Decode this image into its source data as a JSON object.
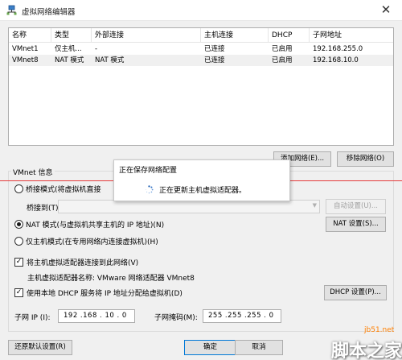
{
  "window": {
    "title": "虚拟网络编辑器",
    "close_glyph": "✕"
  },
  "network_list": {
    "columns": [
      "名称",
      "类型",
      "外部连接",
      "主机连接",
      "DHCP",
      "子网地址"
    ],
    "rows": [
      {
        "name": "VMnet1",
        "type": "仅主机...",
        "external": "-",
        "host": "已连接",
        "dhcp": "已启用",
        "subnet": "192.168.255.0"
      },
      {
        "name": "VMnet8",
        "type": "NAT 模式",
        "external": "NAT 模式",
        "host": "已连接",
        "dhcp": "已启用",
        "subnet": "192.168.10.0"
      }
    ]
  },
  "buttons": {
    "add_network": "添加网络(E)...",
    "remove_network": "移除网络(O)",
    "auto_settings": "自动设置(U)...",
    "nat_settings": "NAT 设置(S)...",
    "dhcp_settings": "DHCP 设置(P)...",
    "restore_defaults": "还原默认设置(R)",
    "ok": "确定",
    "cancel": "取消"
  },
  "vmnet_info": {
    "group_label": "VMnet 信息",
    "bridged_label": "桥接模式(将虚拟机直接",
    "bridged_to_label": "桥接到(T):",
    "nat_label": "NAT 模式(与虚拟机共享主机的 IP 地址)(N)",
    "host_only_label": "仅主机模式(在专用网络内连接虚拟机)(H)",
    "connect_adapter_label": "将主机虚拟适配器连接到此网络(V)",
    "adapter_name_label": "主机虚拟适配器名称: VMware 网络适配器 VMnet8",
    "use_dhcp_label": "使用本地 DHCP 服务将 IP 地址分配给虚拟机(D)",
    "subnet_ip_label": "子网 IP (I):",
    "subnet_ip_value": "192 .168 . 10 . 0",
    "subnet_mask_label": "子网掩码(M):",
    "subnet_mask_value": "255 .255 .255 . 0",
    "selected_mode": "nat",
    "connect_adapter_checked": true,
    "use_dhcp_checked": true
  },
  "progress_dialog": {
    "title": "正在保存网络配置",
    "message": "正在更新主机虚拟适配器。"
  },
  "watermark": {
    "site": "jb51.net",
    "brand": "脚本之家"
  },
  "colors": {
    "accent_border": "#0078d7",
    "red_line": "#e53c3c",
    "watermark_orange": "#ff7f00"
  }
}
